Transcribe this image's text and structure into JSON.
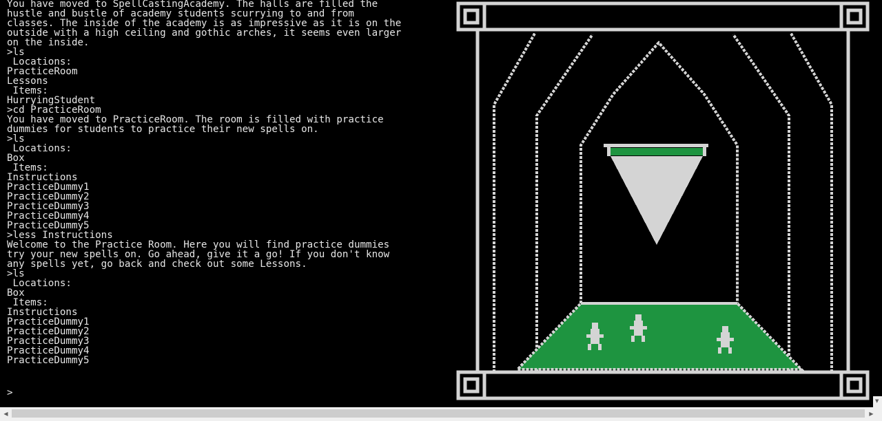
{
  "terminal": {
    "lines": [
      "You have moved to SpellCastingAcademy. The halls are filled the",
      "hustle and bustle of academy students scurrying to and from",
      "classes. The inside of the academy is as impressive as it is on the",
      "outside with a high ceiling and gothic arches, it seems even larger",
      "on the inside.",
      ">ls",
      " Locations:",
      "PracticeRoom",
      "Lessons",
      " Items:",
      "HurryingStudent",
      ">cd PracticeRoom",
      "You have moved to PracticeRoom. The room is filled with practice",
      "dummies for students to practice their new spells on.",
      ">ls",
      " Locations:",
      "Box",
      " Items:",
      "Instructions",
      "PracticeDummy1",
      "PracticeDummy2",
      "PracticeDummy3",
      "PracticeDummy4",
      "PracticeDummy5",
      ">less Instructions",
      "Welcome to the Practice Room. Here you will find practice dummies",
      "try your new spells on. Go ahead, give it a go! If you don't know",
      "any spells yet, go back and check out some Lessons.",
      ">ls",
      " Locations:",
      "Box",
      " Items:",
      "Instructions",
      "PracticeDummy1",
      "PracticeDummy2",
      "PracticeDummy3",
      "PracticeDummy4",
      "PracticeDummy5",
      ">"
    ]
  },
  "scene": {
    "colors": {
      "background": "#000000",
      "line": "#d4d4d4",
      "floor": "#1e9440",
      "hourglass_sand": "#1e9440",
      "hourglass_glass": "#d4d4d4",
      "dummy": "#d4d4d4"
    },
    "icons": [
      "hourglass-icon",
      "practice-dummy-icon"
    ]
  },
  "scrollbars": {
    "left_arrow": "◀",
    "right_arrow": "▶",
    "down_arrow": "▼"
  }
}
